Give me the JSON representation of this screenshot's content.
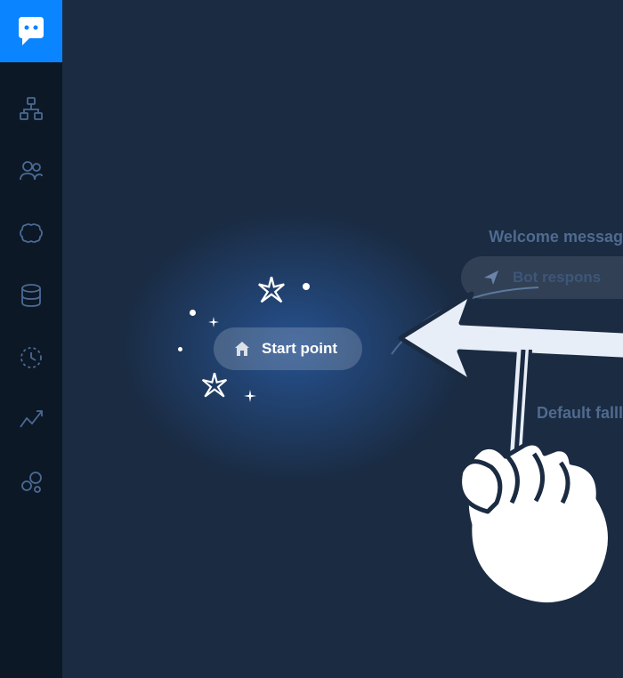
{
  "sidebar": {
    "logo_name": "chatbot-logo"
  },
  "canvas": {
    "start_label": "Start point",
    "welcome_label": "Welcome messag",
    "bot_response_label": "Bot respons",
    "default_fallback_label": "Default falll"
  }
}
